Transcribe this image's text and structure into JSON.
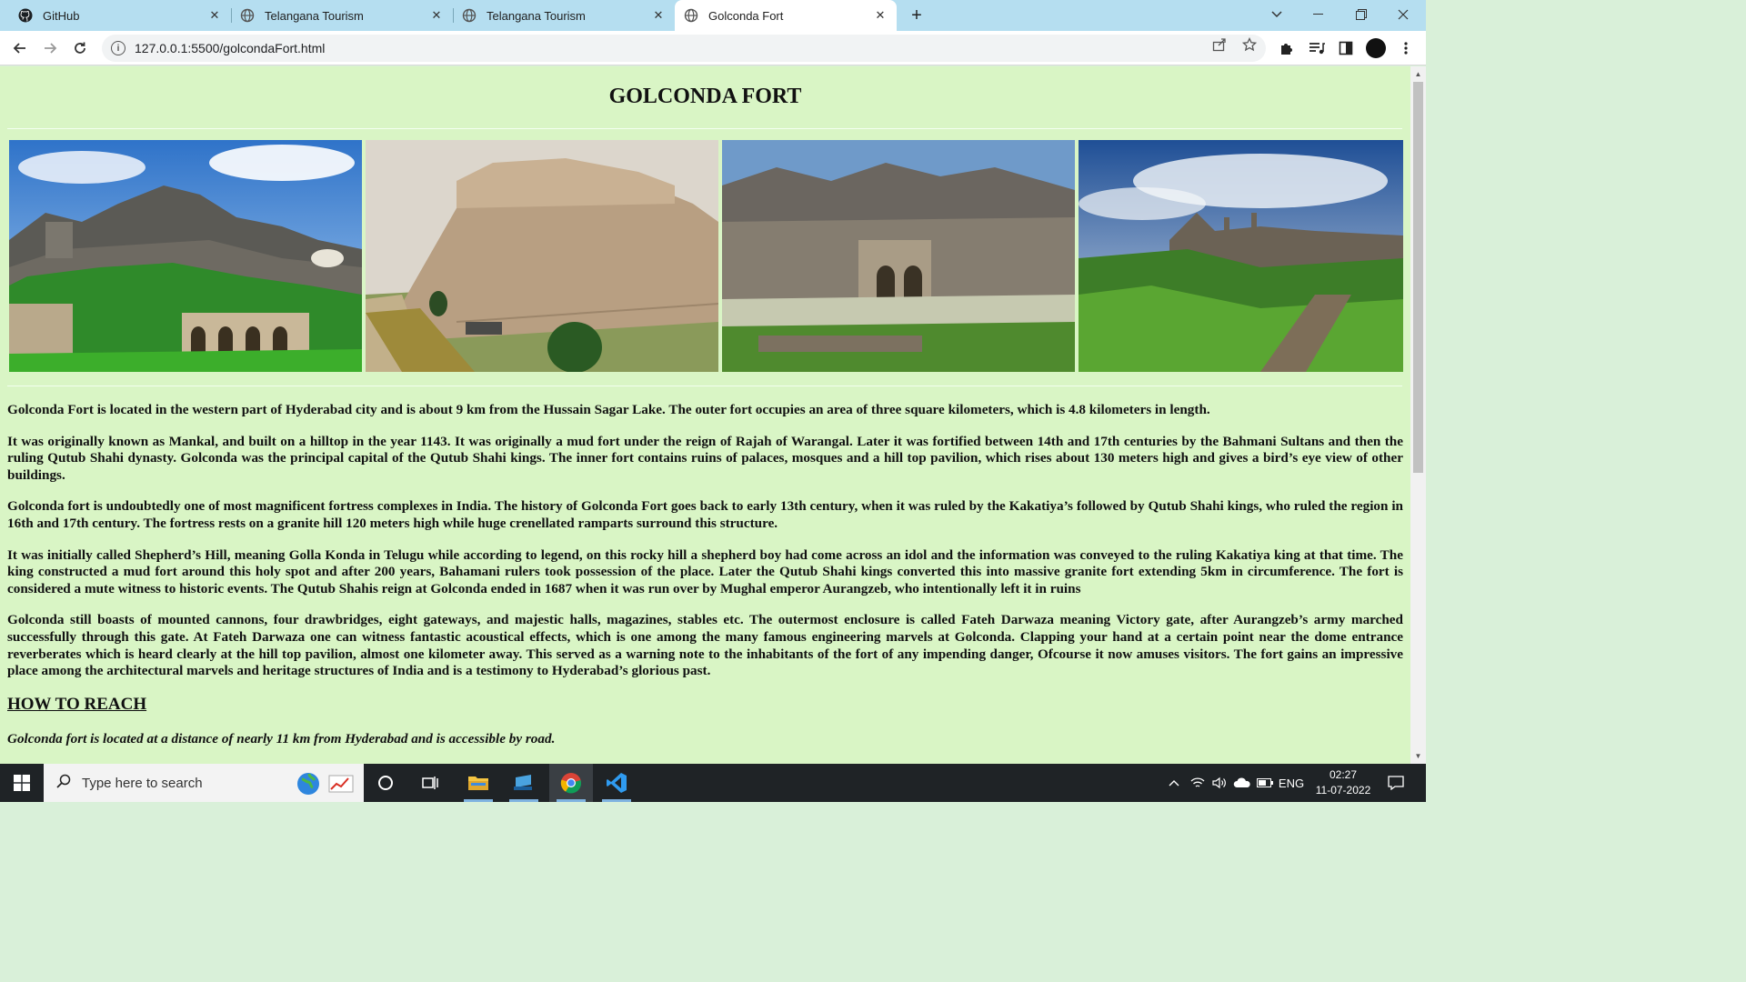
{
  "browser": {
    "tabs": [
      {
        "title": "GitHub",
        "icon": "github-icon",
        "active": false
      },
      {
        "title": "Telangana Tourism",
        "icon": "globe-icon",
        "active": false
      },
      {
        "title": "Telangana Tourism",
        "icon": "globe-icon",
        "active": false
      },
      {
        "title": "Golconda Fort",
        "icon": "globe-icon",
        "active": true
      }
    ],
    "url": "127.0.0.1:5500/golcondaFort.html"
  },
  "page": {
    "title": "GOLCONDA FORT",
    "paragraphs": [
      "Golconda Fort is located in the western part of Hyderabad city and is about 9 km from the Hussain Sagar Lake. The outer fort occupies an area of three square kilometers, which is 4.8 kilometers in length.",
      "It was originally known as Mankal, and built on a hilltop in the year 1143. It was originally a mud fort under the reign of Rajah of Warangal. Later it was fortified between 14th and 17th centuries by the Bahmani Sultans and then the ruling Qutub Shahi dynasty. Golconda was the principal capital of the Qutub Shahi kings. The inner fort contains ruins of palaces, mosques and a hill top pavilion, which rises about 130 meters high and gives a bird’s eye view of other buildings.",
      "Golconda fort is undoubtedly one of most magnificent fortress complexes in India. The history of Golconda Fort goes back to early 13th century, when it was ruled by the Kakatiya’s followed by Qutub Shahi kings, who ruled the region in 16th and 17th century. The fortress rests on a granite hill 120 meters high while huge crenellated ramparts surround this structure.",
      "It was initially called Shepherd’s Hill, meaning Golla Konda in Telugu while according to legend, on this rocky hill a shepherd boy had come across an idol and the information was conveyed to the ruling Kakatiya king at that time. The king constructed a mud fort around this holy spot and after 200 years, Bahamani rulers took possession of the place. Later the Qutub Shahi kings converted this into massive granite fort extending 5km in circumference. The fort is considered a mute witness to historic events. The Qutub Shahis reign at Golconda ended in 1687 when it was run over by Mughal emperor Aurangzeb, who intentionally left it in ruins",
      "Golconda still boasts of mounted cannons, four drawbridges, eight gateways, and majestic halls, magazines, stables etc. The outermost enclosure is called Fateh Darwaza meaning Victory gate, after Aurangzeb’s army marched successfully through this gate. At Fateh Darwaza one can witness fantastic acoustical effects, which is one among the many famous engineering marvels at Golconda. Clapping your hand at a certain point near the dome entrance reverberates which is heard clearly at the hill top pavilion, almost one kilometer away. This served as a warning note to the inhabitants of the fort of any impending danger, Ofcourse it now amuses visitors. The fort gains an impressive place among the architectural marvels and heritage structures of India and is a testimony to Hyderabad’s glorious past."
    ],
    "how_to_reach_heading": "HOW TO REACH",
    "how_to_reach_text": "Golconda fort is located at a distance of nearly 11 km from Hyderabad and is accessible by road."
  },
  "taskbar": {
    "search_placeholder": "Type here to search",
    "language": "ENG",
    "time": "02:27",
    "date": "11-07-2022"
  },
  "colors": {
    "page_background": "#d9f5c5",
    "tabbar_background": "#b5def0",
    "taskbar_background": "#1f2326"
  }
}
